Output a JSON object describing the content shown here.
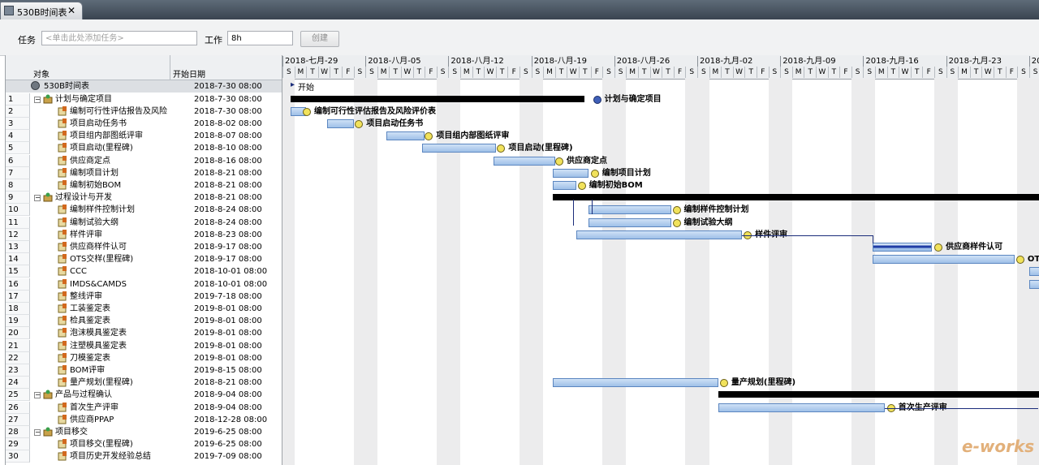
{
  "window": {
    "tab_title": "530B时间表",
    "close_symbol": "✕"
  },
  "toolbar": {
    "task_label": "任务",
    "task_placeholder": "<单击此处添加任务>",
    "work_label": "工作",
    "work_value": "8h",
    "create_label": "创建"
  },
  "grid": {
    "col_object": "对象",
    "col_start": "开始日期",
    "root": {
      "name": "530B时间表",
      "start": "2018-7-30 08:00"
    },
    "rows": [
      {
        "num": "1",
        "name": "计划与确定项目",
        "start": "2018-7-30 08:00",
        "level": 1,
        "expand": "−"
      },
      {
        "num": "2",
        "name": "编制可行性评估报告及风险",
        "start": "2018-7-30 08:00",
        "level": 2
      },
      {
        "num": "3",
        "name": "项目启动任务书",
        "start": "2018-8-02 08:00",
        "level": 2
      },
      {
        "num": "4",
        "name": "项目组内部图纸评审",
        "start": "2018-8-07 08:00",
        "level": 2
      },
      {
        "num": "5",
        "name": "项目启动(里程碑)",
        "start": "2018-8-10 08:00",
        "level": 2
      },
      {
        "num": "6",
        "name": "供应商定点",
        "start": "2018-8-16 08:00",
        "level": 2
      },
      {
        "num": "7",
        "name": "编制项目计划",
        "start": "2018-8-21 08:00",
        "level": 2
      },
      {
        "num": "8",
        "name": "编制初始BOM",
        "start": "2018-8-21 08:00",
        "level": 2
      },
      {
        "num": "9",
        "name": "过程设计与开发",
        "start": "2018-8-21 08:00",
        "level": 1,
        "expand": "−"
      },
      {
        "num": "10",
        "name": "编制样件控制计划",
        "start": "2018-8-24 08:00",
        "level": 2
      },
      {
        "num": "11",
        "name": "编制试验大纲",
        "start": "2018-8-24 08:00",
        "level": 2
      },
      {
        "num": "12",
        "name": "样件评审",
        "start": "2018-8-23 08:00",
        "level": 2
      },
      {
        "num": "13",
        "name": "供应商样件认可",
        "start": "2018-9-17 08:00",
        "level": 2
      },
      {
        "num": "14",
        "name": "OTS交样(里程碑)",
        "start": "2018-9-17 08:00",
        "level": 2
      },
      {
        "num": "15",
        "name": "CCC",
        "start": "2018-10-01 08:00",
        "level": 2
      },
      {
        "num": "16",
        "name": "IMDS&CAMDS",
        "start": "2018-10-01 08:00",
        "level": 2
      },
      {
        "num": "17",
        "name": "整线评审",
        "start": "2019-7-18 08:00",
        "level": 2
      },
      {
        "num": "18",
        "name": "工装鉴定表",
        "start": "2019-8-01 08:00",
        "level": 2
      },
      {
        "num": "19",
        "name": "检具鉴定表",
        "start": "2019-8-01 08:00",
        "level": 2
      },
      {
        "num": "20",
        "name": "泡沫模具鉴定表",
        "start": "2019-8-01 08:00",
        "level": 2
      },
      {
        "num": "21",
        "name": "注塑模具鉴定表",
        "start": "2019-8-01 08:00",
        "level": 2
      },
      {
        "num": "22",
        "name": "刀模鉴定表",
        "start": "2019-8-01 08:00",
        "level": 2
      },
      {
        "num": "23",
        "name": "BOM评审",
        "start": "2019-8-15 08:00",
        "level": 2
      },
      {
        "num": "24",
        "name": "量产规划(里程碑)",
        "start": "2018-8-21 08:00",
        "level": 2
      },
      {
        "num": "25",
        "name": "产品与过程确认",
        "start": "2018-9-04 08:00",
        "level": 1,
        "expand": "−"
      },
      {
        "num": "26",
        "name": "首次生产评审",
        "start": "2018-9-04 08:00",
        "level": 2
      },
      {
        "num": "27",
        "name": "供应商PPAP",
        "start": "2018-12-28 08:00",
        "level": 2
      },
      {
        "num": "28",
        "name": "项目移交",
        "start": "2019-6-25 08:00",
        "level": 1,
        "expand": "−"
      },
      {
        "num": "29",
        "name": "项目移交(里程碑)",
        "start": "2019-6-25 08:00",
        "level": 2
      },
      {
        "num": "30",
        "name": "项目历史开发经验总结",
        "start": "2019-7-09 08:00",
        "level": 2
      }
    ]
  },
  "gantt": {
    "weeks": [
      "2018-七月-29",
      "2018-八月-05",
      "2018-八月-12",
      "2018-八月-19",
      "2018-八月-26",
      "2018-九月-02",
      "2018-九月-09",
      "2018-九月-16",
      "2018-九月-23",
      "20"
    ],
    "day_letters": [
      "S",
      "M",
      "T",
      "W",
      "T",
      "F",
      "S"
    ],
    "start_marker": "开始",
    "labels": {
      "r1": "计划与确定项目",
      "r2": "编制可行性评估报告及风险评价表",
      "r3": "项目启动任务书",
      "r4": "项目组内部图纸评审",
      "r5": "项目启动(里程碑)",
      "r6": "供应商定点",
      "r7": "编制项目计划",
      "r8": "编制初始BOM",
      "r10": "编制样件控制计划",
      "r11": "编制试验大纲",
      "r12": "样件评审",
      "r13": "供应商样件认可",
      "r14": "OT",
      "r24": "量产规划(里程碑)",
      "r26": "首次生产评审"
    },
    "colors": {
      "bar_fill": "#b3cff0",
      "bar_border": "#5b86c0",
      "summary": "#000000",
      "milestone": "#f1e25c",
      "link": "#1a2c7a"
    }
  },
  "watermark": "e-works"
}
